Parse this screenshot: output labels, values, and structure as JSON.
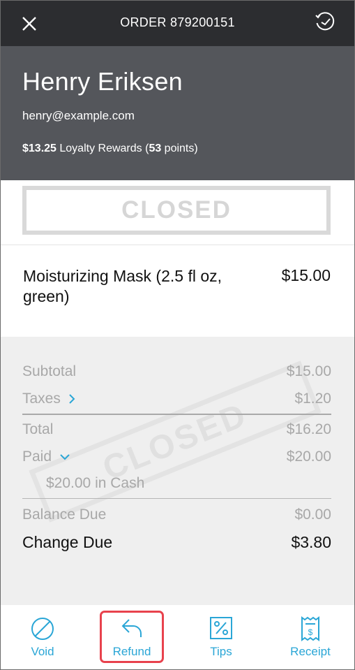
{
  "header": {
    "title": "ORDER 879200151",
    "close_icon": "close-icon",
    "history_icon": "clock-history-icon"
  },
  "customer": {
    "name": "Henry Eriksen",
    "email": "henry@example.com",
    "loyalty_amount": "$13.25",
    "loyalty_text": " Loyalty Rewards (",
    "loyalty_points": "53",
    "loyalty_suffix": " points)"
  },
  "status": "CLOSED",
  "item": {
    "name": "Moisturizing Mask (2.5 fl oz, green)",
    "price": "$15.00"
  },
  "summary": {
    "watermark": "CLOSED",
    "subtotal_label": "Subtotal",
    "subtotal": "$15.00",
    "taxes_label": "Taxes",
    "taxes": "$1.20",
    "total_label": "Total",
    "total": "$16.20",
    "paid_label": "Paid",
    "paid": "$20.00",
    "paid_detail": "$20.00 in Cash",
    "balance_label": "Balance Due",
    "balance": "$0.00",
    "change_label": "Change Due",
    "change": "$3.80"
  },
  "actions": [
    {
      "label": "Void",
      "icon": "void-icon"
    },
    {
      "label": "Refund",
      "icon": "refund-icon"
    },
    {
      "label": "Tips",
      "icon": "percent-icon"
    },
    {
      "label": "Receipt",
      "icon": "receipt-icon"
    }
  ],
  "colors": {
    "accent": "#2aa6d6",
    "highlight": "#e8424d",
    "header_bg": "#2c2d30",
    "customer_bg": "#54565b"
  }
}
